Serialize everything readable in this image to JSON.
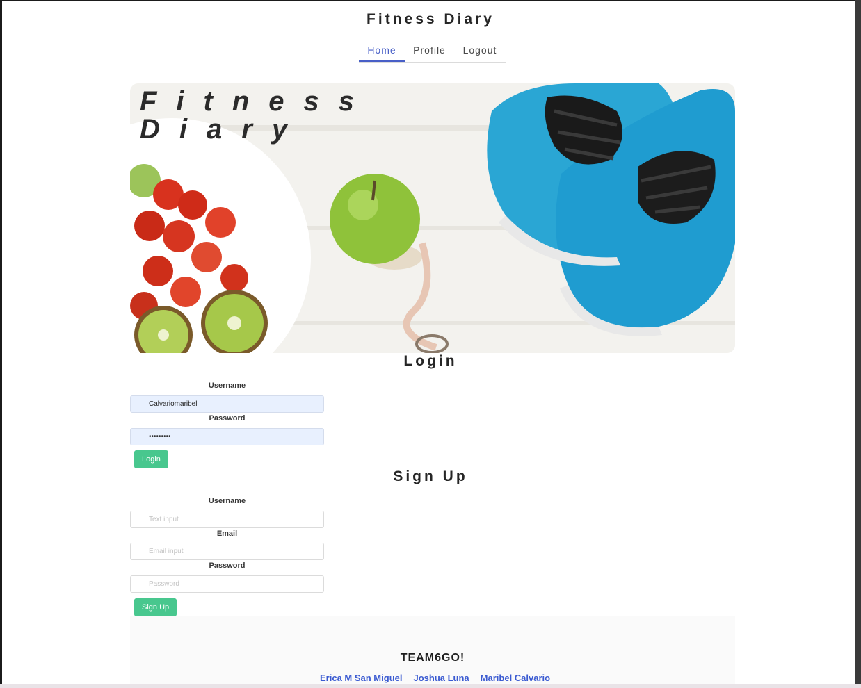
{
  "header": {
    "site_title": "Fitness Diary",
    "nav": [
      {
        "label": "Home",
        "active": true
      },
      {
        "label": "Profile",
        "active": false
      },
      {
        "label": "Logout",
        "active": false
      }
    ]
  },
  "hero": {
    "title_line1": "Fitness",
    "title_line2": "Diary",
    "image_description_icon": "fruit-apple-tape-sneakers-image"
  },
  "login": {
    "heading": "Login",
    "username_label": "Username",
    "username_value": "Calvariomaribel",
    "password_label": "Password",
    "password_value": "•••••••••",
    "submit_label": "Login"
  },
  "signup": {
    "heading": "Sign Up",
    "username_label": "Username",
    "username_placeholder": "Text input",
    "email_label": "Email",
    "email_placeholder": "Email input",
    "password_label": "Password",
    "password_placeholder": "Password",
    "submit_label": "Sign Up"
  },
  "footer": {
    "team_name": "TEAM6GO!",
    "members": [
      "Erica M San Miguel",
      "Joshua Luna",
      "Maribel Calvario"
    ]
  },
  "colors": {
    "accent_link": "#485fc7",
    "button_green": "#48c78e",
    "autofill_bg": "#e8f0fe",
    "footer_link": "#3a5ad1"
  }
}
